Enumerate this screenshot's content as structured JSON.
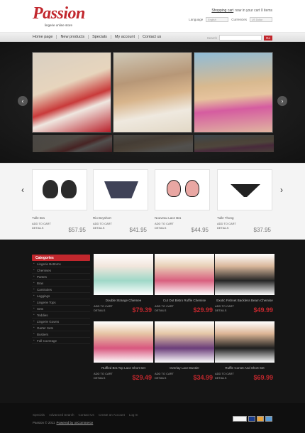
{
  "header": {
    "logo": "Passion",
    "tagline": "lingerie online store",
    "cart_link": "Shopping cart",
    "cart_text": "now in your cart 0 items",
    "language_label": "Language",
    "language_value": "English",
    "currencies_label": "Currencies",
    "currency_value": "US Dollar"
  },
  "nav": {
    "items": [
      {
        "label": "Home page"
      },
      {
        "label": "New products"
      },
      {
        "label": "Specials"
      },
      {
        "label": "My account"
      },
      {
        "label": "Contact us"
      }
    ],
    "search_label": "Search",
    "go_label": "Go"
  },
  "slider": {
    "prev_icon": "chevron-left-icon",
    "next_icon": "chevron-right-icon"
  },
  "products": [
    {
      "name": "Tulle Bra",
      "add": "ADD TO CART",
      "details": "DETAILS",
      "price": "$57.95"
    },
    {
      "name": "Rio Boyshort",
      "add": "ADD TO CART",
      "details": "DETAILS",
      "price": "$41.95"
    },
    {
      "name": "Nouveau Lace Bra",
      "add": "ADD TO CART",
      "details": "DETAILS",
      "price": "$44.95"
    },
    {
      "name": "Tulle Thong",
      "add": "ADD TO CART",
      "details": "DETAILS",
      "price": "$37.95"
    }
  ],
  "sidebar": {
    "heading": "Categories",
    "items": [
      {
        "label": "Lingerie Bottoms"
      },
      {
        "label": "Chemises"
      },
      {
        "label": "Pantes"
      },
      {
        "label": "Bras"
      },
      {
        "label": "Camisoles"
      },
      {
        "label": "Leggings"
      },
      {
        "label": "Lingerie Tops"
      },
      {
        "label": "Sets"
      },
      {
        "label": "Teddies"
      },
      {
        "label": "Lingerie Gowns"
      },
      {
        "label": "Garter Sets"
      },
      {
        "label": "Bustiers"
      },
      {
        "label": "Full Coverage"
      }
    ]
  },
  "grid": [
    {
      "name": "Double Strange Chiemee",
      "add": "ADD TO CART",
      "details": "DETAILS",
      "price": "$79.39"
    },
    {
      "name": "Cut Out Bistro Ruffle Chemise",
      "add": "ADD TO CART",
      "details": "DETAILS",
      "price": "$29.99"
    },
    {
      "name": "Exotic Fishnet Backless Beam Chemise",
      "add": "ADD TO CART",
      "details": "DETAILS",
      "price": "$49.99"
    },
    {
      "name": "Ruffled Bra Top Lace Short Set",
      "add": "ADD TO CART",
      "details": "DETAILS",
      "price": "$29.49"
    },
    {
      "name": "Overlay Lace Bustier",
      "add": "ADD TO CART",
      "details": "DETAILS",
      "price": "$34.99"
    },
    {
      "name": "Ruffle Corset And Short Set",
      "add": "ADD TO CART",
      "details": "DETAILS",
      "price": "$69.99"
    }
  ],
  "footer": {
    "links": [
      {
        "label": "Specials"
      },
      {
        "label": "Advanced Search"
      },
      {
        "label": "Contact Us"
      },
      {
        "label": "Create an Account"
      },
      {
        "label": "Log In"
      }
    ],
    "copyright": "Passion © 2011",
    "powered": "Powered by osCommerce",
    "payment_icons": [
      "paypal-icon",
      "visa-icon",
      "mastercard-icon",
      "amex-icon"
    ]
  }
}
